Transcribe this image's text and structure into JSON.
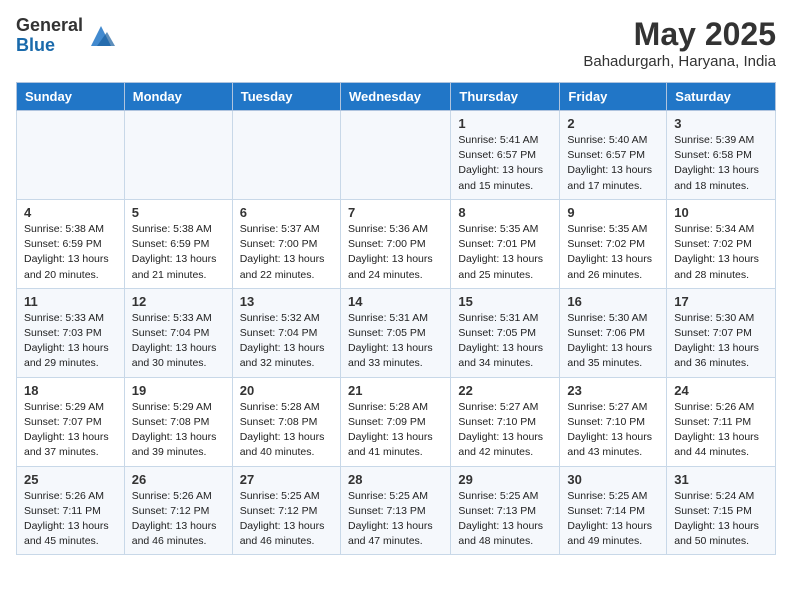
{
  "header": {
    "logo_general": "General",
    "logo_blue": "Blue",
    "month": "May 2025",
    "location": "Bahadurgarh, Haryana, India"
  },
  "days_of_week": [
    "Sunday",
    "Monday",
    "Tuesday",
    "Wednesday",
    "Thursday",
    "Friday",
    "Saturday"
  ],
  "weeks": [
    [
      {
        "num": "",
        "detail": ""
      },
      {
        "num": "",
        "detail": ""
      },
      {
        "num": "",
        "detail": ""
      },
      {
        "num": "",
        "detail": ""
      },
      {
        "num": "1",
        "detail": "Sunrise: 5:41 AM\nSunset: 6:57 PM\nDaylight: 13 hours\nand 15 minutes."
      },
      {
        "num": "2",
        "detail": "Sunrise: 5:40 AM\nSunset: 6:57 PM\nDaylight: 13 hours\nand 17 minutes."
      },
      {
        "num": "3",
        "detail": "Sunrise: 5:39 AM\nSunset: 6:58 PM\nDaylight: 13 hours\nand 18 minutes."
      }
    ],
    [
      {
        "num": "4",
        "detail": "Sunrise: 5:38 AM\nSunset: 6:59 PM\nDaylight: 13 hours\nand 20 minutes."
      },
      {
        "num": "5",
        "detail": "Sunrise: 5:38 AM\nSunset: 6:59 PM\nDaylight: 13 hours\nand 21 minutes."
      },
      {
        "num": "6",
        "detail": "Sunrise: 5:37 AM\nSunset: 7:00 PM\nDaylight: 13 hours\nand 22 minutes."
      },
      {
        "num": "7",
        "detail": "Sunrise: 5:36 AM\nSunset: 7:00 PM\nDaylight: 13 hours\nand 24 minutes."
      },
      {
        "num": "8",
        "detail": "Sunrise: 5:35 AM\nSunset: 7:01 PM\nDaylight: 13 hours\nand 25 minutes."
      },
      {
        "num": "9",
        "detail": "Sunrise: 5:35 AM\nSunset: 7:02 PM\nDaylight: 13 hours\nand 26 minutes."
      },
      {
        "num": "10",
        "detail": "Sunrise: 5:34 AM\nSunset: 7:02 PM\nDaylight: 13 hours\nand 28 minutes."
      }
    ],
    [
      {
        "num": "11",
        "detail": "Sunrise: 5:33 AM\nSunset: 7:03 PM\nDaylight: 13 hours\nand 29 minutes."
      },
      {
        "num": "12",
        "detail": "Sunrise: 5:33 AM\nSunset: 7:04 PM\nDaylight: 13 hours\nand 30 minutes."
      },
      {
        "num": "13",
        "detail": "Sunrise: 5:32 AM\nSunset: 7:04 PM\nDaylight: 13 hours\nand 32 minutes."
      },
      {
        "num": "14",
        "detail": "Sunrise: 5:31 AM\nSunset: 7:05 PM\nDaylight: 13 hours\nand 33 minutes."
      },
      {
        "num": "15",
        "detail": "Sunrise: 5:31 AM\nSunset: 7:05 PM\nDaylight: 13 hours\nand 34 minutes."
      },
      {
        "num": "16",
        "detail": "Sunrise: 5:30 AM\nSunset: 7:06 PM\nDaylight: 13 hours\nand 35 minutes."
      },
      {
        "num": "17",
        "detail": "Sunrise: 5:30 AM\nSunset: 7:07 PM\nDaylight: 13 hours\nand 36 minutes."
      }
    ],
    [
      {
        "num": "18",
        "detail": "Sunrise: 5:29 AM\nSunset: 7:07 PM\nDaylight: 13 hours\nand 37 minutes."
      },
      {
        "num": "19",
        "detail": "Sunrise: 5:29 AM\nSunset: 7:08 PM\nDaylight: 13 hours\nand 39 minutes."
      },
      {
        "num": "20",
        "detail": "Sunrise: 5:28 AM\nSunset: 7:08 PM\nDaylight: 13 hours\nand 40 minutes."
      },
      {
        "num": "21",
        "detail": "Sunrise: 5:28 AM\nSunset: 7:09 PM\nDaylight: 13 hours\nand 41 minutes."
      },
      {
        "num": "22",
        "detail": "Sunrise: 5:27 AM\nSunset: 7:10 PM\nDaylight: 13 hours\nand 42 minutes."
      },
      {
        "num": "23",
        "detail": "Sunrise: 5:27 AM\nSunset: 7:10 PM\nDaylight: 13 hours\nand 43 minutes."
      },
      {
        "num": "24",
        "detail": "Sunrise: 5:26 AM\nSunset: 7:11 PM\nDaylight: 13 hours\nand 44 minutes."
      }
    ],
    [
      {
        "num": "25",
        "detail": "Sunrise: 5:26 AM\nSunset: 7:11 PM\nDaylight: 13 hours\nand 45 minutes."
      },
      {
        "num": "26",
        "detail": "Sunrise: 5:26 AM\nSunset: 7:12 PM\nDaylight: 13 hours\nand 46 minutes."
      },
      {
        "num": "27",
        "detail": "Sunrise: 5:25 AM\nSunset: 7:12 PM\nDaylight: 13 hours\nand 46 minutes."
      },
      {
        "num": "28",
        "detail": "Sunrise: 5:25 AM\nSunset: 7:13 PM\nDaylight: 13 hours\nand 47 minutes."
      },
      {
        "num": "29",
        "detail": "Sunrise: 5:25 AM\nSunset: 7:13 PM\nDaylight: 13 hours\nand 48 minutes."
      },
      {
        "num": "30",
        "detail": "Sunrise: 5:25 AM\nSunset: 7:14 PM\nDaylight: 13 hours\nand 49 minutes."
      },
      {
        "num": "31",
        "detail": "Sunrise: 5:24 AM\nSunset: 7:15 PM\nDaylight: 13 hours\nand 50 minutes."
      }
    ]
  ]
}
